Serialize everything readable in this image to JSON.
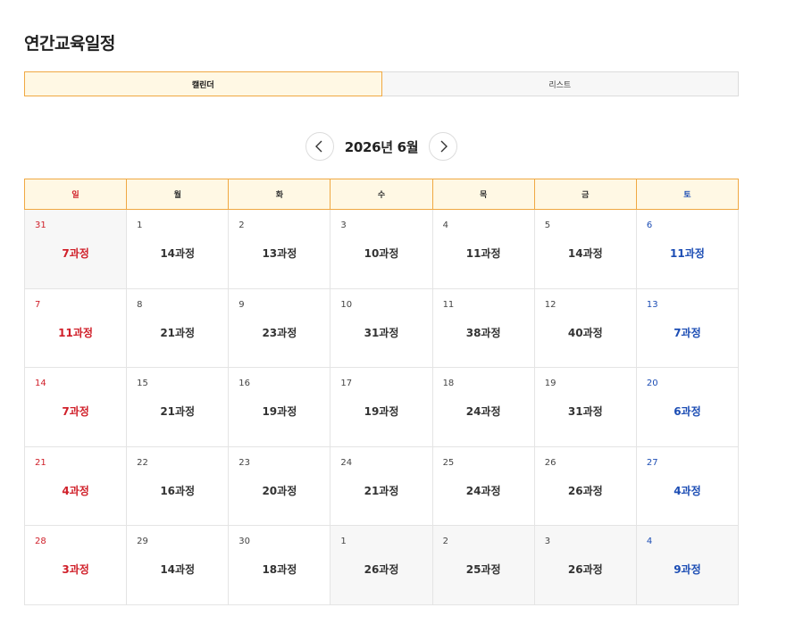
{
  "page": {
    "title": "연간교육일정"
  },
  "tabs": [
    {
      "label": "캘린더",
      "active": true
    },
    {
      "label": "리스트",
      "active": false
    }
  ],
  "month_nav": {
    "label": "2026년 6월",
    "prev_icon": "chevron-left-icon",
    "next_icon": "chevron-right-icon"
  },
  "weekdays": [
    "일",
    "월",
    "화",
    "수",
    "목",
    "금",
    "토"
  ],
  "weeks": [
    [
      {
        "day": "31",
        "count": "7과정",
        "other": true
      },
      {
        "day": "1",
        "count": "14과정"
      },
      {
        "day": "2",
        "count": "13과정"
      },
      {
        "day": "3",
        "count": "10과정"
      },
      {
        "day": "4",
        "count": "11과정"
      },
      {
        "day": "5",
        "count": "14과정"
      },
      {
        "day": "6",
        "count": "11과정"
      }
    ],
    [
      {
        "day": "7",
        "count": "11과정"
      },
      {
        "day": "8",
        "count": "21과정"
      },
      {
        "day": "9",
        "count": "23과정"
      },
      {
        "day": "10",
        "count": "31과정"
      },
      {
        "day": "11",
        "count": "38과정"
      },
      {
        "day": "12",
        "count": "40과정"
      },
      {
        "day": "13",
        "count": "7과정"
      }
    ],
    [
      {
        "day": "14",
        "count": "7과정"
      },
      {
        "day": "15",
        "count": "21과정"
      },
      {
        "day": "16",
        "count": "19과정"
      },
      {
        "day": "17",
        "count": "19과정"
      },
      {
        "day": "18",
        "count": "24과정"
      },
      {
        "day": "19",
        "count": "31과정"
      },
      {
        "day": "20",
        "count": "6과정"
      }
    ],
    [
      {
        "day": "21",
        "count": "4과정"
      },
      {
        "day": "22",
        "count": "16과정"
      },
      {
        "day": "23",
        "count": "20과정"
      },
      {
        "day": "24",
        "count": "21과정"
      },
      {
        "day": "25",
        "count": "24과정"
      },
      {
        "day": "26",
        "count": "26과정"
      },
      {
        "day": "27",
        "count": "4과정"
      }
    ],
    [
      {
        "day": "28",
        "count": "3과정"
      },
      {
        "day": "29",
        "count": "14과정"
      },
      {
        "day": "30",
        "count": "18과정"
      },
      {
        "day": "1",
        "count": "26과정",
        "other": true
      },
      {
        "day": "2",
        "count": "25과정",
        "other": true
      },
      {
        "day": "3",
        "count": "26과정",
        "other": true
      },
      {
        "day": "4",
        "count": "9과정",
        "other": true
      }
    ]
  ],
  "colors": {
    "accent": "#f0a842",
    "header_bg": "#fff8e4",
    "sunday": "#d0202a",
    "saturday": "#1c4db4",
    "other_month_bg": "#f7f7f7"
  }
}
